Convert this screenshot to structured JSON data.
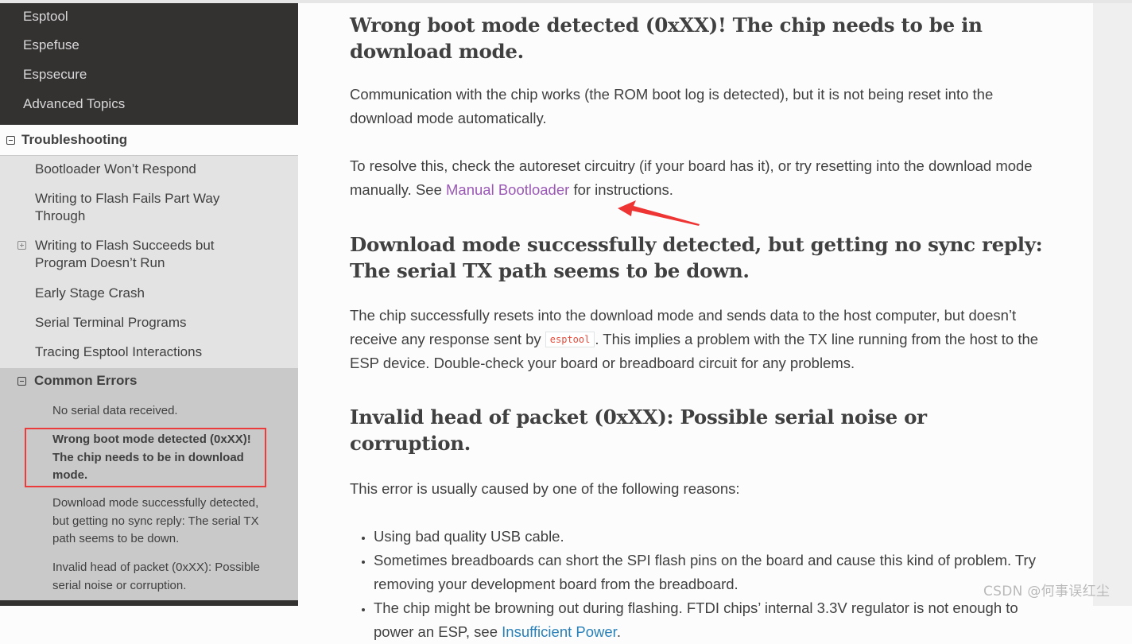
{
  "sidebar": {
    "top_items": [
      {
        "label": "Esptool"
      },
      {
        "label": "Espefuse"
      },
      {
        "label": "Espsecure"
      },
      {
        "label": "Advanced Topics"
      }
    ],
    "current_section": {
      "label": "Troubleshooting",
      "toggle_icon": "minus-square-icon"
    },
    "subsections": [
      {
        "label": "Bootloader Won’t Respond"
      },
      {
        "label": "Writing to Flash Fails Part Way Through"
      },
      {
        "label": "Writing to Flash Succeeds but Program Doesn’t Run",
        "toggle_icon": "plus-square-icon"
      },
      {
        "label": "Early Stage Crash"
      },
      {
        "label": "Serial Terminal Programs"
      },
      {
        "label": "Tracing Esptool Interactions"
      }
    ],
    "expanded_subsection": {
      "label": "Common Errors",
      "toggle_icon": "minus-square-icon",
      "items": [
        {
          "label": "No serial data received.",
          "current": false
        },
        {
          "label": "Wrong boot mode detected (0xXX)! The chip needs to be in download mode.",
          "current": true
        },
        {
          "label": "Download mode successfully detected, but getting no sync reply: The serial TX path seems to be down.",
          "current": false
        },
        {
          "label": "Invalid head of packet (0xXX): Possible serial noise or corruption.",
          "current": false
        }
      ]
    },
    "highlight_color": "#ec3b3b"
  },
  "content": {
    "sections": [
      {
        "heading": "Wrong boot mode detected (0xXX)! The chip needs to be in download mode.",
        "p1": "Communication with the chip works (the ROM boot log is detected), but it is not being reset into the download mode automatically.",
        "p2_before": "To resolve this, check the autoreset circuitry (if your board has it), or try resetting into the download mode manually. See ",
        "p2_link": "Manual Bootloader",
        "p2_after": " for instructions."
      },
      {
        "heading": "Download mode successfully detected, but getting no sync reply: The serial TX path seems to be down.",
        "p1_before": "The chip successfully resets into the download mode and sends data to the host computer, but doesn’t receive any response sent by ",
        "p1_code": "esptool",
        "p1_after": ". This implies a problem with the TX line running from the host to the ESP device. Double-check your board or breadboard circuit for any problems."
      },
      {
        "heading": "Invalid head of packet (0xXX): Possible serial noise or corruption.",
        "intro": "This error is usually caused by one of the following reasons:",
        "bullets": [
          {
            "text": "Using bad quality USB cable."
          },
          {
            "text": "Sometimes breadboards can short the SPI flash pins on the board and cause this kind of problem. Try removing your development board from the breadboard."
          },
          {
            "before": "The chip might be browning out during flashing. FTDI chips’ internal 3.3V regulator is not enough to power an ESP, see ",
            "link": "Insufficient Power",
            "after": "."
          }
        ]
      }
    ],
    "link_color": "#9b59b6",
    "code_color": "#e74c3c"
  },
  "annotation": {
    "arrow_color": "#ef3434"
  },
  "watermark": "CSDN @何事误红尘"
}
